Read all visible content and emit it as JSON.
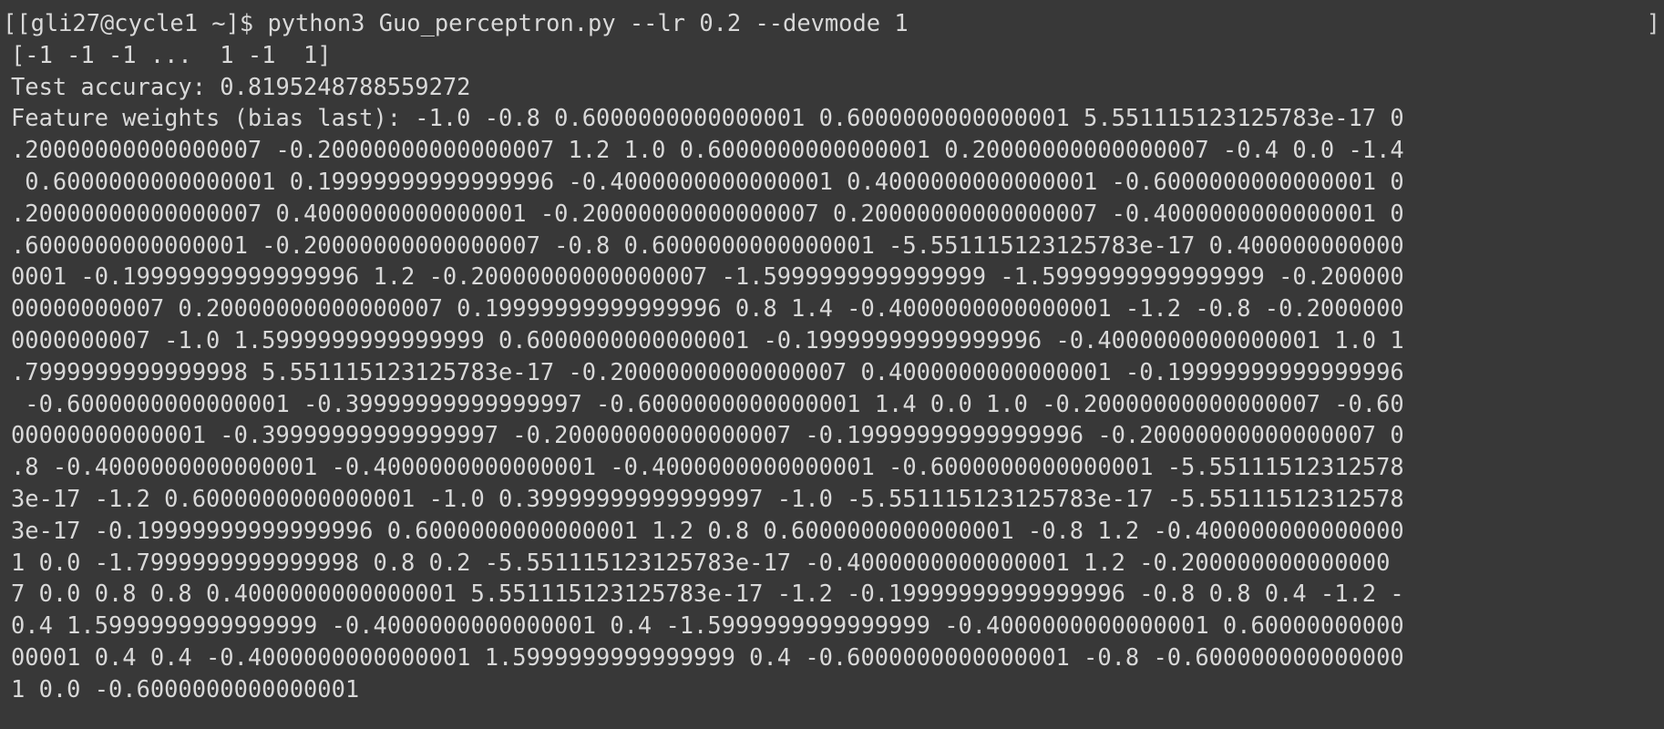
{
  "terminal": {
    "right_marker": "]",
    "lines": [
      "[[gli27@cycle1 ~]$ python3 Guo_perceptron.py --lr 0.2 --devmode 1",
      "[-1 -1 -1 ...  1 -1  1]",
      "Test accuracy: 0.8195248788559272",
      "Feature weights (bias last): -1.0 -0.8 0.6000000000000001 0.6000000000000001 5.551115123125783e-17 0",
      ".20000000000000007 -0.20000000000000007 1.2 1.0 0.6000000000000001 0.20000000000000007 -0.4 0.0 -1.4",
      " 0.6000000000000001 0.19999999999999996 -0.4000000000000001 0.4000000000000001 -0.6000000000000001 0",
      ".20000000000000007 0.4000000000000001 -0.20000000000000007 0.20000000000000007 -0.4000000000000001 0",
      ".6000000000000001 -0.20000000000000007 -0.8 0.6000000000000001 -5.551115123125783e-17 0.400000000000",
      "0001 -0.19999999999999996 1.2 -0.20000000000000007 -1.5999999999999999 -1.5999999999999999 -0.200000",
      "00000000007 0.20000000000000007 0.19999999999999996 0.8 1.4 -0.4000000000000001 -1.2 -0.8 -0.2000000",
      "0000000007 -1.0 1.5999999999999999 0.6000000000000001 -0.19999999999999996 -0.4000000000000001 1.0 1",
      ".7999999999999998 5.551115123125783e-17 -0.20000000000000007 0.4000000000000001 -0.19999999999999996",
      " -0.6000000000000001 -0.39999999999999997 -0.6000000000000001 1.4 0.0 1.0 -0.20000000000000007 -0.60",
      "00000000000001 -0.39999999999999997 -0.20000000000000007 -0.19999999999999996 -0.20000000000000007 0",
      ".8 -0.4000000000000001 -0.4000000000000001 -0.4000000000000001 -0.6000000000000001 -5.55111512312578",
      "3e-17 -1.2 0.6000000000000001 -1.0 0.39999999999999997 -1.0 -5.551115123125783e-17 -5.55111512312578",
      "3e-17 -0.19999999999999996 0.6000000000000001 1.2 0.8 0.6000000000000001 -0.8 1.2 -0.400000000000000",
      "1 0.0 -1.7999999999999998 0.8 0.2 -5.551115123125783e-17 -0.4000000000000001 1.2 -0.200000000000000",
      "7 0.0 0.8 0.8 0.4000000000000001 5.551115123125783e-17 -1.2 -0.19999999999999996 -0.8 0.8 0.4 -1.2 -",
      "0.4 1.5999999999999999 -0.4000000000000001 0.4 -1.5999999999999999 -0.4000000000000001 0.60000000000",
      "00001 0.4 0.4 -0.4000000000000001 1.5999999999999999 0.4 -0.6000000000000001 -0.8 -0.600000000000000",
      "1 0.0 -0.6000000000000001"
    ]
  }
}
